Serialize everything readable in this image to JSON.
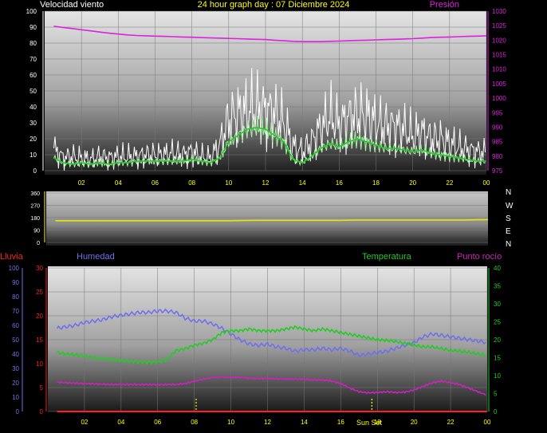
{
  "colors": {
    "wind_gust": "#ffffff",
    "wind_avg": "#22cc22",
    "wind_light": "#a8f0a8",
    "pressure": "#e020e0",
    "direction": "#e8e800",
    "humidity": "#7070ee",
    "temperature": "#22cc22",
    "dewpoint": "#d020c0",
    "rain": "#ff2020",
    "sun_marker": "#ffff00",
    "text_yellow": "#ffff00",
    "bg": "#000000"
  },
  "chart_data": [
    {
      "type": "line",
      "title": "24 hour graph day : 07 Diciembre 2024",
      "left_label": "Velocidad viento",
      "right_label": "Presión",
      "x_ticks": [
        "02",
        "04",
        "06",
        "08",
        "10",
        "12",
        "14",
        "16",
        "18",
        "20",
        "22",
        "00"
      ],
      "y_left_ticks": [
        "0",
        "10",
        "20",
        "30",
        "40",
        "50",
        "60",
        "70",
        "80",
        "90",
        "100"
      ],
      "y_right_ticks": [
        "975",
        "980",
        "985",
        "990",
        "995",
        "1000",
        "1005",
        "1010",
        "1015",
        "1020",
        "1025",
        "1030"
      ],
      "ylim_left": [
        0,
        100
      ],
      "ylim_right": [
        975,
        1030
      ],
      "x_hours": [
        0.5,
        1,
        1.5,
        2,
        2.5,
        3,
        3.5,
        4,
        4.5,
        5,
        5.5,
        6,
        6.5,
        7,
        7.5,
        8,
        8.5,
        9,
        9.5,
        10,
        10.5,
        11,
        11.5,
        12,
        12.5,
        13,
        13.5,
        14,
        14.5,
        15,
        15.5,
        16,
        16.5,
        17,
        17.5,
        18,
        18.5,
        19,
        19.5,
        20,
        20.5,
        21,
        21.5,
        22,
        22.5,
        23,
        23.5,
        24
      ],
      "series": [
        {
          "name": "gust",
          "values": [
            14,
            8,
            9,
            8,
            7,
            9,
            8,
            9,
            9,
            9,
            10,
            10,
            10,
            11,
            10,
            12,
            9,
            8,
            16,
            32,
            36,
            37,
            40,
            38,
            36,
            30,
            15,
            12,
            18,
            27,
            34,
            29,
            33,
            35,
            34,
            30,
            28,
            28,
            26,
            22,
            24,
            20,
            20,
            17,
            15,
            13,
            12,
            11
          ]
        },
        {
          "name": "avg",
          "values": [
            8,
            5,
            4,
            5,
            4,
            5,
            4,
            5,
            5,
            6,
            6,
            6,
            6,
            6,
            6,
            7,
            6,
            5,
            8,
            18,
            22,
            26,
            27,
            26,
            22,
            18,
            7,
            5,
            9,
            14,
            17,
            15,
            18,
            20,
            18,
            16,
            14,
            14,
            13,
            12,
            13,
            11,
            10,
            9,
            8,
            7,
            6,
            6
          ]
        },
        {
          "name": "Presión",
          "values": [
            1024.8,
            1024.4,
            1024.0,
            1023.6,
            1023.2,
            1022.8,
            1022.4,
            1022.1,
            1021.8,
            1021.6,
            1021.5,
            1021.4,
            1021.3,
            1021.2,
            1021.1,
            1021.0,
            1020.9,
            1020.8,
            1020.7,
            1020.6,
            1020.5,
            1020.4,
            1020.3,
            1020.2,
            1020.0,
            1019.8,
            1019.6,
            1019.5,
            1019.5,
            1019.5,
            1019.6,
            1019.7,
            1019.8,
            1019.9,
            1020.0,
            1020.1,
            1020.2,
            1020.3,
            1020.4,
            1020.5,
            1020.7,
            1020.9,
            1021.0,
            1021.1,
            1021.2,
            1021.3,
            1021.4,
            1021.5
          ]
        }
      ]
    },
    {
      "type": "line",
      "y_ticks": [
        "0",
        "90",
        "180",
        "270",
        "360"
      ],
      "ylim": [
        0,
        360
      ],
      "compass": [
        "N",
        "W",
        "S",
        "E",
        "N"
      ],
      "series": [
        {
          "name": "direction",
          "values": [
            158,
            158,
            158,
            158,
            158,
            158,
            158,
            158,
            158,
            158,
            158,
            158,
            158,
            158,
            158,
            158,
            158,
            158,
            158,
            158,
            159,
            160,
            161,
            161,
            161,
            161,
            161,
            161,
            161,
            161,
            161,
            161,
            162,
            163,
            163,
            163,
            163,
            163,
            163,
            163,
            163,
            163,
            163,
            163,
            163,
            164,
            165,
            165
          ]
        }
      ]
    },
    {
      "type": "line",
      "labels": {
        "rain": "Lluvia",
        "humidity": "Humedad",
        "temperature": "Temperatura",
        "dewpoint": "Punto rocío"
      },
      "x_ticks": [
        "02",
        "04",
        "06",
        "08",
        "10",
        "12",
        "14",
        "16",
        "18",
        "20",
        "22",
        "00"
      ],
      "y_humidity_ticks": [
        "0",
        "10",
        "20",
        "30",
        "40",
        "50",
        "60",
        "70",
        "80",
        "90",
        "100"
      ],
      "y_rain_ticks": [
        "0",
        "5",
        "10",
        "15",
        "20",
        "25",
        "30"
      ],
      "y_temp_ticks": [
        "0",
        "5",
        "10",
        "15",
        "20",
        "25",
        "30",
        "35",
        "40"
      ],
      "ylim_temp": [
        0,
        40
      ],
      "ylim_humidity": [
        0,
        100
      ],
      "sun_label": "Sun Set",
      "sun_marks": [
        8.1,
        17.7
      ],
      "series": [
        {
          "name": "Humedad",
          "values": [
            58,
            59,
            60,
            62,
            63,
            64,
            66,
            67,
            68,
            69,
            69,
            70,
            70,
            69,
            65,
            63,
            63,
            61,
            58,
            54,
            50,
            47,
            46,
            47,
            45,
            44,
            42,
            43,
            43,
            44,
            43,
            44,
            42,
            39,
            40,
            41,
            42,
            44,
            46,
            48,
            52,
            54,
            53,
            52,
            51,
            50,
            49,
            48
          ]
        },
        {
          "name": "Temperatura",
          "values": [
            16.5,
            16,
            15.8,
            15.5,
            15,
            14.8,
            14.5,
            14.2,
            14,
            13.8,
            13.7,
            13.8,
            14.5,
            17,
            17.5,
            18.5,
            19,
            20,
            22,
            22.5,
            22.5,
            23,
            22.5,
            22.5,
            22.5,
            23,
            23.5,
            23,
            22.5,
            23,
            22.5,
            22,
            21.5,
            21,
            20.5,
            20,
            19.8,
            19.5,
            19,
            18.5,
            18,
            18,
            17.5,
            17,
            16.8,
            16.5,
            16,
            15.5
          ]
        },
        {
          "name": "Punto rocío",
          "values": [
            8.2,
            8,
            7.9,
            7.8,
            7.7,
            7.6,
            7.5,
            7.5,
            7.5,
            7.5,
            7.5,
            7.5,
            7.5,
            7.5,
            7.8,
            8.4,
            9,
            9.5,
            9.6,
            9.5,
            9.5,
            9.3,
            9.2,
            9.2,
            9.1,
            9,
            9,
            9,
            8.8,
            8.8,
            8.5,
            7.8,
            6.5,
            5.5,
            5.2,
            5.3,
            5.5,
            5.3,
            5.4,
            6,
            7,
            8,
            8.5,
            8,
            7.5,
            6.5,
            5.5,
            4.5
          ]
        },
        {
          "name": "Lluvia",
          "values": [
            0,
            0,
            0,
            0,
            0,
            0,
            0,
            0,
            0,
            0,
            0,
            0,
            0,
            0,
            0,
            0,
            0,
            0,
            0,
            0,
            0,
            0,
            0,
            0,
            0,
            0,
            0,
            0,
            0,
            0,
            0,
            0,
            0,
            0,
            0,
            0,
            0,
            0,
            0,
            0,
            0,
            0,
            0,
            0,
            0,
            0,
            0,
            0
          ]
        }
      ]
    }
  ]
}
